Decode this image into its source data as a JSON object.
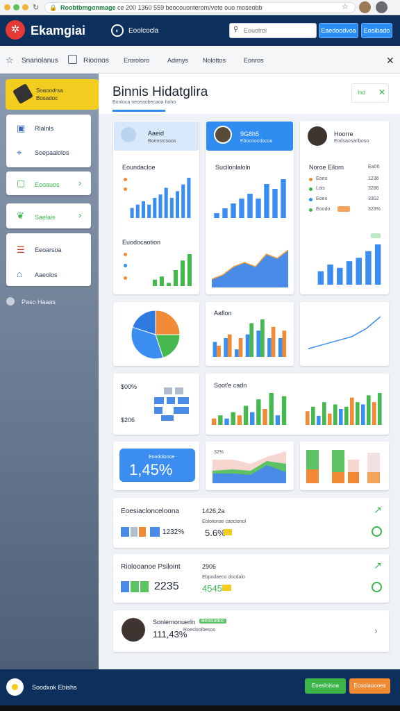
{
  "browser": {
    "url_prefix": "Roobtbmgonmage",
    "url_rest": "ce 200 1360 559 beocouonterom/vete ouo moseobb"
  },
  "header": {
    "app_name": "Ekamgiai",
    "dashboard_label": "Eoolcocla",
    "search_placeholder": "Eouolroi",
    "btn1": "Eaedoodvoa",
    "btn2": "Eosibado"
  },
  "subnav": {
    "items": [
      "Snanolanus",
      "Rioonos",
      "Eroroloro",
      "Adirnys",
      "Nolottos",
      "Eonros"
    ]
  },
  "sidebar": {
    "top_label1": "Soaoodrsa",
    "top_label2": "Bosadoc",
    "items": [
      "Rlalnls",
      "Soepaalolos",
      "Eooauos",
      "Saelais",
      "Eeoarsoa",
      "Aaeolos"
    ],
    "footer_label": "Paso Haaas"
  },
  "main": {
    "title": "Binnis Hidatglira",
    "subtitle": "Bonloca neoeaobecaoa hoho"
  },
  "profiles": [
    {
      "name": "Aaeid",
      "sub": "Boeosrcsoos"
    },
    {
      "name": "9G8h5",
      "sub": "Ebocnocdocoa"
    },
    {
      "name": "Hoorre",
      "sub": "Eodsaosarlboso"
    }
  ],
  "card_titles": {
    "c1": "Eoundacloe",
    "c2": "Sucilonlaloln",
    "c3": "Noroe Eilorn",
    "c3b": "Ea06",
    "c4": "Euodocaotion",
    "c5": "Aaflon",
    "c6": "$00%",
    "c6b": "$206",
    "c7": "Soot'e cadn",
    "c8": "32%"
  },
  "list_rows": [
    {
      "label": "Eoeo",
      "val": "1236"
    },
    {
      "label": "Lois",
      "val": "3286"
    },
    {
      "label": "Eoeo",
      "val": "3302"
    },
    {
      "label": "Eoodo",
      "val": "323%"
    }
  ],
  "kpi": {
    "label": "Eoodolonoe",
    "value": "1,45%"
  },
  "rows": [
    {
      "title": "Eoesiaclonceloona",
      "val_a": "1232%",
      "mid_label": "1426,2a",
      "mid_sub": "Eolotenoe caoclonol",
      "mid_val": "5.6%"
    },
    {
      "title": "Riolooanoe Psiloint",
      "val_a": "2235",
      "mid_label": "2906",
      "mid_sub": "Ebpodaeco docdalo",
      "mid_val": "4545"
    },
    {
      "title": "Sonlernonuerln",
      "val_a": "111,43%",
      "badge": "Belosodoc",
      "sub": "Roesloolbesoo"
    }
  ],
  "footer": {
    "label": "Soodxok Ebishs",
    "btn_green": "Eoesloisoa",
    "btn_orange": "Eosolaoooes"
  },
  "chart_data": [
    {
      "type": "bar",
      "title": "Eoundacloe",
      "values": [
        3,
        4,
        5,
        4,
        6,
        7,
        9,
        6,
        8,
        10,
        12
      ]
    },
    {
      "type": "bar",
      "title": "Sucilonlaloln",
      "values": [
        1,
        2,
        3,
        4,
        5,
        4,
        7,
        6,
        8
      ]
    },
    {
      "type": "bar",
      "title": "Noroe Eilorn",
      "values": [
        4,
        6,
        5,
        7,
        8,
        10,
        12
      ]
    },
    {
      "type": "bar",
      "title": "Euodocaotion",
      "values": [
        2,
        3,
        1,
        5,
        8,
        10
      ]
    },
    {
      "type": "area",
      "values": [
        2,
        3,
        5,
        6,
        5,
        8,
        7,
        9
      ]
    },
    {
      "type": "pie",
      "values": [
        25,
        20,
        35,
        20
      ]
    },
    {
      "type": "bar",
      "title": "Aaflon",
      "series": [
        {
          "values": [
            4,
            5,
            2,
            6,
            7,
            5,
            5
          ]
        },
        {
          "values": [
            3,
            6,
            5,
            9,
            10,
            8,
            7
          ]
        }
      ]
    },
    {
      "type": "line",
      "values": [
        1,
        2,
        3,
        4,
        6,
        9
      ]
    }
  ]
}
